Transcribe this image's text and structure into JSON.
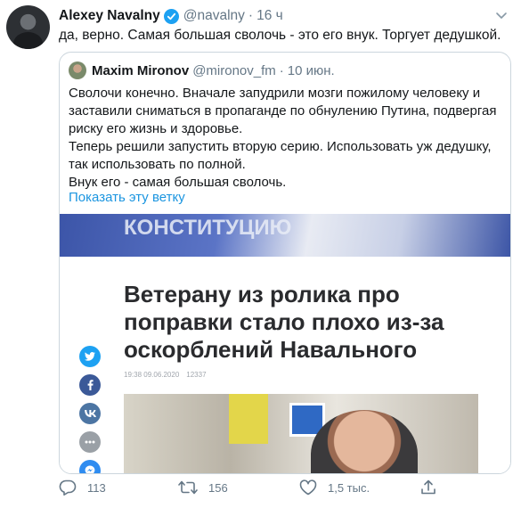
{
  "tweet": {
    "author_name": "Alexey Navalny",
    "handle": "@navalny",
    "separator": "·",
    "time": "16 ч",
    "text": "да, верно. Самая большая сволочь - это его внук. Торгует дедушкой."
  },
  "quote": {
    "author_name": "Maxim Mironov",
    "handle": "@mironov_fm",
    "separator": "·",
    "time": "10 июн.",
    "paragraphs": [
      "Сволочи конечно. Вначале запудрили мозги пожилому человеку и заставили сниматься в пропаганде по обнулению Путина, подвергая риску его жизнь и здоровье.",
      "Теперь решили запустить вторую серию. Использовать уж дедушку, так использовать по полной.",
      "Внук его - самая большая сволочь."
    ],
    "show_thread": "Показать эту ветку",
    "media": {
      "banner_text": "КОНСТИТУЦИЮ",
      "headline": "Ветерану из ролика про поправки стало плохо из-за оскорблений Навального",
      "meta_time": "19:38 09.06.2020",
      "meta_views": "12337"
    }
  },
  "actions": {
    "reply_count": "113",
    "retweet_count": "156",
    "like_count": "1,5 тыс."
  },
  "colors": {
    "verified": "#1da1f2",
    "link": "#1b95e0",
    "muted": "#657786",
    "share_twitter": "#1da1f2",
    "share_facebook": "#3b5998",
    "share_vk": "#4c75a3",
    "share_more": "#9aa0a6",
    "share_messenger": "#2f8cf0"
  },
  "icons": [
    "verified-badge-icon",
    "caret-down-icon",
    "twitter-share-icon",
    "facebook-share-icon",
    "vk-share-icon",
    "more-share-icon",
    "messenger-share-icon",
    "reply-icon",
    "retweet-icon",
    "like-icon",
    "share-icon"
  ]
}
